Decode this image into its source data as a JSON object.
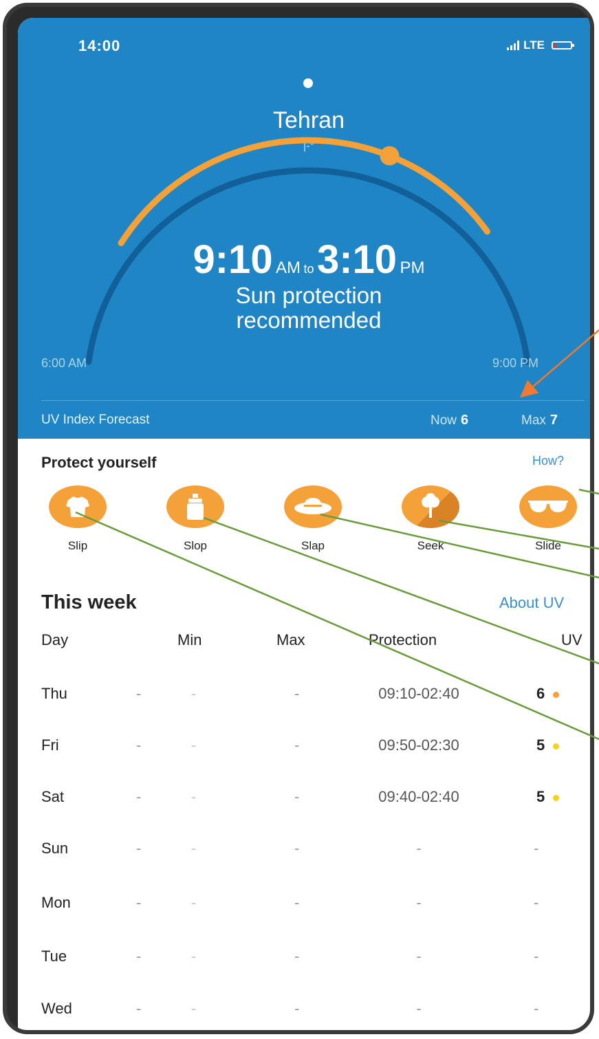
{
  "status": {
    "time": "14:00",
    "network": "LTE"
  },
  "location": {
    "city": "Tehran",
    "temperature": "|-°"
  },
  "protection_window": {
    "start_time": "9:10",
    "start_suffix": "AM",
    "connector": "to",
    "end_time": "3:10",
    "end_suffix": "PM",
    "message_line1": "Sun protection",
    "message_line2": "recommended",
    "arc_start_label": "6:00 AM",
    "arc_end_label": "9:00 PM",
    "sun_progress": 0.62
  },
  "uv_forecast": {
    "title": "UV Index Forecast",
    "now_label": "Now",
    "now_value": "6",
    "max_label": "Max",
    "max_value": "7"
  },
  "protect": {
    "title": "Protect yourself",
    "how_link": "How?",
    "tips": [
      {
        "label": "Slip",
        "icon": "shirt-icon"
      },
      {
        "label": "Slop",
        "icon": "sunscreen-icon"
      },
      {
        "label": "Slap",
        "icon": "hat-icon"
      },
      {
        "label": "Seek",
        "icon": "tree-icon"
      },
      {
        "label": "Slide",
        "icon": "sunglasses-icon"
      }
    ]
  },
  "week": {
    "title": "This week",
    "about_link": "About UV",
    "headers": {
      "day": "Day",
      "min": "Min",
      "max": "Max",
      "protection": "Protection",
      "uv": "UV"
    },
    "rows": [
      {
        "day": "Thu",
        "d1": "-",
        "min": "-",
        "max": "-",
        "protection": "09:10-02:40",
        "uv": "6",
        "uv_color": "#f5a13a"
      },
      {
        "day": "Fri",
        "d1": "-",
        "min": "-",
        "max": "-",
        "protection": "09:50-02:30",
        "uv": "5",
        "uv_color": "#f7d21b"
      },
      {
        "day": "Sat",
        "d1": "-",
        "min": "-",
        "max": "-",
        "protection": "09:40-02:40",
        "uv": "5",
        "uv_color": "#f7d21b"
      },
      {
        "day": "Sun",
        "d1": "-",
        "min": "-",
        "max": "-",
        "protection": "-",
        "uv": "-",
        "uv_color": ""
      },
      {
        "day": "Mon",
        "d1": "-",
        "min": "-",
        "max": "-",
        "protection": "-",
        "uv": "-",
        "uv_color": ""
      },
      {
        "day": "Tue",
        "d1": "-",
        "min": "-",
        "max": "-",
        "protection": "-",
        "uv": "-",
        "uv_color": ""
      },
      {
        "day": "Wed",
        "d1": "-",
        "min": "-",
        "max": "-",
        "protection": "-",
        "uv": "-",
        "uv_color": ""
      }
    ]
  },
  "colors": {
    "header_blue": "#1f85c4",
    "accent_orange": "#f5a13a",
    "link_blue": "#3a90c8",
    "annotation_green": "#6a9a3a",
    "annotation_orange": "#ef7a30"
  }
}
